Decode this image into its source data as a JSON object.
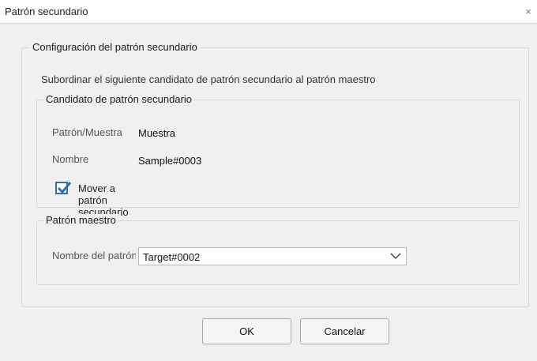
{
  "window": {
    "title": "Patrón secundario",
    "close_glyph": "×"
  },
  "config_group": {
    "legend": "Configuración del patrón secundario",
    "description": "Subordinar el siguiente candidato de patrón secundario al patrón maestro"
  },
  "candidate_group": {
    "legend": "Candidato de patrón secundario",
    "fields": [
      {
        "label": "Patrón/Muestra",
        "value": "Muestra"
      },
      {
        "label": "Nombre",
        "value": "Sample#0003"
      }
    ],
    "checkbox": {
      "label": "Mover a patrón secundario",
      "checked": true
    }
  },
  "master_group": {
    "legend": "Patrón maestro",
    "field_label": "Nombre del patrón",
    "selected_value": "Target#0002"
  },
  "buttons": {
    "ok": "OK",
    "cancel": "Cancelar"
  },
  "colors": {
    "checkbox_accent": "#2f6eb3",
    "dialog_background": "#f0f0f0"
  }
}
